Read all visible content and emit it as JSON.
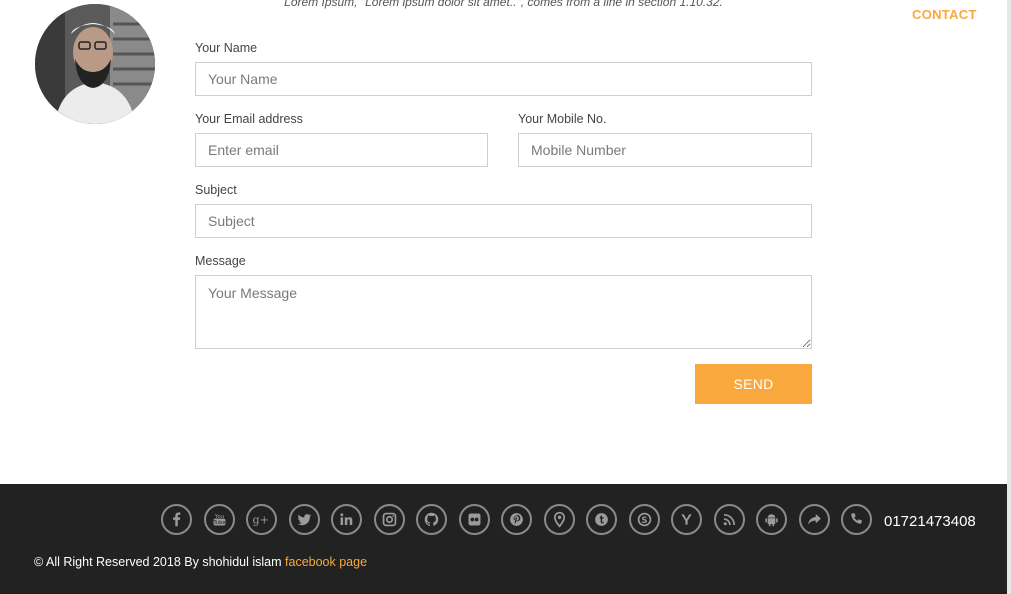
{
  "header": {
    "tagline": "Lorem Ipsum, \"Lorem ipsum dolor sit amet..\", comes from a line in section 1.10.32.",
    "nav_contact": "CONTACT"
  },
  "form": {
    "name": {
      "label": "Your Name",
      "placeholder": "Your Name",
      "value": ""
    },
    "email": {
      "label": "Your Email address",
      "placeholder": "Enter email",
      "value": ""
    },
    "mobile": {
      "label": "Your Mobile No.",
      "placeholder": "Mobile Number",
      "value": ""
    },
    "subject": {
      "label": "Subject",
      "placeholder": "Subject",
      "value": ""
    },
    "message": {
      "label": "Message",
      "placeholder": "Your Message",
      "value": ""
    },
    "send_label": "SEND"
  },
  "footer": {
    "social_icons": [
      "facebook-icon",
      "youtube-icon",
      "google-plus-icon",
      "twitter-icon",
      "linkedin-icon",
      "instagram-icon",
      "github-icon",
      "flickr-icon",
      "pinterest-icon",
      "map-marker-icon",
      "tumblr-icon",
      "skype-icon",
      "yahoo-icon",
      "rss-icon",
      "android-icon",
      "share-icon",
      "phone-icon"
    ],
    "phone": "01721473408",
    "copyright": "© All Right Reserved 2018 By shohidul islam",
    "facebook_link": "facebook page"
  },
  "colors": {
    "accent": "#f9a83d",
    "footer_bg": "#222222",
    "icon_gray": "#8a8a8a"
  }
}
